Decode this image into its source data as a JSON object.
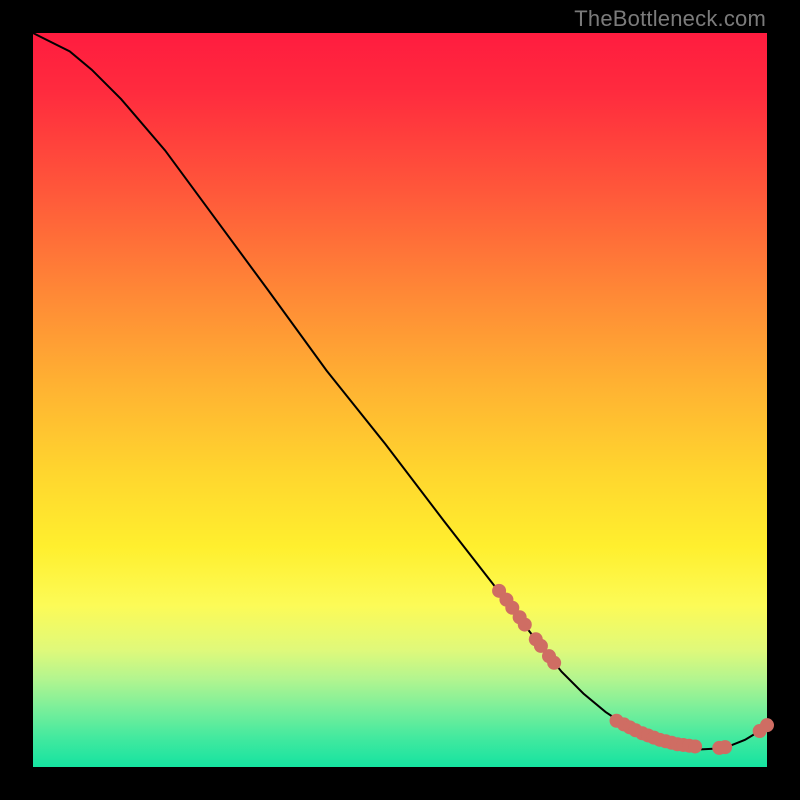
{
  "watermark": "TheBottleneck.com",
  "chart_data": {
    "type": "line",
    "title": "",
    "xlabel": "",
    "ylabel": "",
    "xlim": [
      0,
      100
    ],
    "ylim": [
      0,
      100
    ],
    "grid": false,
    "legend": false,
    "series": [
      {
        "name": "bottleneck-curve",
        "x": [
          0,
          2,
          5,
          8,
          12,
          18,
          25,
          32,
          40,
          48,
          56,
          63,
          68,
          72,
          75,
          78,
          81,
          83,
          85,
          87,
          89,
          91,
          93,
          95,
          97,
          99,
          100
        ],
        "y": [
          100,
          99,
          97.5,
          95,
          91,
          84,
          74.5,
          65,
          54,
          44,
          33.5,
          24.5,
          18,
          13,
          10,
          7.5,
          5.5,
          4.2,
          3.3,
          2.8,
          2.5,
          2.4,
          2.5,
          2.9,
          3.7,
          4.9,
          5.7
        ],
        "color": "#000000",
        "stroke_width": 2
      }
    ],
    "markers": [
      {
        "name": "cluster-descending",
        "color": "#cf6d63",
        "radius": 7,
        "points": [
          {
            "x": 63.5,
            "y": 24.0
          },
          {
            "x": 64.5,
            "y": 22.8
          },
          {
            "x": 65.3,
            "y": 21.7
          },
          {
            "x": 66.3,
            "y": 20.4
          },
          {
            "x": 67.0,
            "y": 19.4
          },
          {
            "x": 68.5,
            "y": 17.4
          },
          {
            "x": 69.2,
            "y": 16.5
          },
          {
            "x": 70.3,
            "y": 15.1
          },
          {
            "x": 71.0,
            "y": 14.2
          }
        ]
      },
      {
        "name": "cluster-bottom",
        "color": "#cf6d63",
        "radius": 7,
        "points": [
          {
            "x": 79.5,
            "y": 6.3
          },
          {
            "x": 80.5,
            "y": 5.8
          },
          {
            "x": 81.3,
            "y": 5.4
          },
          {
            "x": 82.1,
            "y": 5.0
          },
          {
            "x": 83.0,
            "y": 4.6
          },
          {
            "x": 83.8,
            "y": 4.3
          },
          {
            "x": 84.6,
            "y": 4.0
          },
          {
            "x": 85.4,
            "y": 3.7
          },
          {
            "x": 86.2,
            "y": 3.5
          },
          {
            "x": 87.0,
            "y": 3.3
          },
          {
            "x": 87.8,
            "y": 3.1
          },
          {
            "x": 88.6,
            "y": 3.0
          },
          {
            "x": 89.4,
            "y": 2.9
          },
          {
            "x": 90.2,
            "y": 2.8
          }
        ]
      },
      {
        "name": "cluster-minimum",
        "color": "#cf6d63",
        "radius": 7,
        "points": [
          {
            "x": 93.5,
            "y": 2.6
          },
          {
            "x": 94.3,
            "y": 2.7
          }
        ]
      },
      {
        "name": "cluster-uptick",
        "color": "#cf6d63",
        "radius": 7,
        "points": [
          {
            "x": 99.0,
            "y": 4.9
          },
          {
            "x": 100.0,
            "y": 5.7
          }
        ]
      }
    ]
  }
}
